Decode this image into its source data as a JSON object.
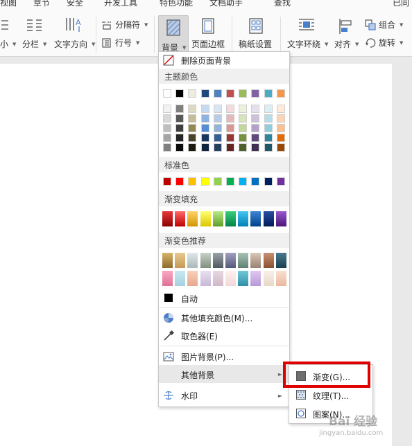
{
  "menubar": {
    "items": [
      "视图",
      "章节",
      "开发工具",
      "特色功能",
      "文档助手",
      "查找",
      "已同"
    ]
  },
  "ribbon": {
    "size_label": "小",
    "columns_label": "分栏",
    "text_direction_label": "文字方向",
    "separator_label": "分隔符",
    "line_number_label": "行号",
    "background_label": "背景",
    "page_border_label": "页面边框",
    "paper_setting_label": "稿纸设置",
    "wrap_label": "文字环绕",
    "align_label": "对齐",
    "group_label": "组合",
    "rotate_label": "旋转"
  },
  "menu": {
    "remove_bg": "删除页面背景",
    "theme_colors_header": "主题颜色",
    "standard_colors_header": "标准色",
    "gradient_fill_header": "渐变填充",
    "gradient_recommend_header": "渐变色推荐",
    "auto_label": "自动",
    "other_fill_color": "其他填充颜色(M)...",
    "eyedropper": "取色器(E)",
    "picture_bg": "图片背景(P)...",
    "other_bg": "其他背景",
    "watermark": "水印"
  },
  "submenu": {
    "gradient": "渐变(G)...",
    "texture": "纹理(T)...",
    "pattern": "图案(N)..."
  },
  "colors": {
    "theme_top": [
      "#ffffff",
      "#000000",
      "#eeece1",
      "#1f497d",
      "#4f81bd",
      "#c0504d",
      "#9bbb59",
      "#8064a2",
      "#4bacc6",
      "#f79646"
    ],
    "theme_shades": [
      [
        "#f2f2f2",
        "#d8d8d8",
        "#bfbfbf",
        "#a5a5a5",
        "#7f7f7f"
      ],
      [
        "#7f7f7f",
        "#595959",
        "#3f3f3f",
        "#262626",
        "#0c0c0c"
      ],
      [
        "#ddd9c3",
        "#c4bd97",
        "#938953",
        "#494429",
        "#1d1b10"
      ],
      [
        "#c6d9f0",
        "#8db3e2",
        "#548dd4",
        "#17365d",
        "#0f243e"
      ],
      [
        "#dbe5f1",
        "#b8cce4",
        "#95b3d7",
        "#366092",
        "#244061"
      ],
      [
        "#f2dcdb",
        "#e5b9b7",
        "#d99694",
        "#953734",
        "#632423"
      ],
      [
        "#ebf1dd",
        "#d7e3bc",
        "#c3d69b",
        "#76923c",
        "#4f6128"
      ],
      [
        "#e5e0ec",
        "#ccc1d9",
        "#b2a2c7",
        "#5f497a",
        "#3f3151"
      ],
      [
        "#dbeef3",
        "#b7dde8",
        "#92cddc",
        "#31859b",
        "#205867"
      ],
      [
        "#fdeada",
        "#fbd5b5",
        "#fac08f",
        "#e36c09",
        "#974806"
      ]
    ],
    "standard": [
      "#c00000",
      "#ff0000",
      "#ffc000",
      "#ffff00",
      "#92d050",
      "#00b050",
      "#00b0f0",
      "#0070c0",
      "#002060",
      "#7030a0"
    ],
    "gradient_fill": [
      [
        "#e8363a",
        "#8b0000"
      ],
      [
        "#ff6a6a",
        "#c00000"
      ],
      [
        "#ffd36a",
        "#d39500"
      ],
      [
        "#ffff70",
        "#d9c800"
      ],
      [
        "#b8e986",
        "#5f9e2a"
      ],
      [
        "#3ccf7a",
        "#00804a"
      ],
      [
        "#43c5f5",
        "#0080b5"
      ],
      [
        "#3c86d6",
        "#00408a"
      ],
      [
        "#2a4fa0",
        "#001a5c"
      ],
      [
        "#9a56cf",
        "#4a1678"
      ]
    ],
    "gradient_recommend_row1": [
      [
        "#d8b36a",
        "#8c6a2a"
      ],
      [
        "#e8c98f",
        "#c49a55"
      ],
      [
        "#e0e8e8",
        "#aab8b8"
      ],
      [
        "#c8d2c8",
        "#7f8f7f"
      ],
      [
        "#9aa2aa",
        "#505860"
      ],
      [
        "#a0a0c0",
        "#585878"
      ],
      [
        "#a8c4b8",
        "#5f8070"
      ],
      [
        "#d8c8b8",
        "#9a8070"
      ],
      [
        "#c89070",
        "#8a5030"
      ],
      [
        "#4a7a90",
        "#1a4050"
      ]
    ],
    "gradient_recommend_row2": [
      [
        "#f8a8c0",
        "#e07098"
      ],
      [
        "#c8e8f0",
        "#a8d0e0"
      ],
      [
        "#f8d0b8",
        "#e8a890"
      ],
      [
        "#e8e0f0",
        "#c8b8d8"
      ],
      [
        "#e8d8e0",
        "#d0b8c8"
      ],
      [
        "#fff0f0",
        "#f0d8d8"
      ],
      [
        "#70c8d8",
        "#3090a8"
      ],
      [
        "#e0c8f0",
        "#b898d8"
      ],
      [
        "#f8f0e8",
        "#e8d8c8"
      ],
      [
        "#fae0d0",
        "#eab8a0"
      ]
    ],
    "highlight": "#e00000",
    "accent_blue": "#4a7fcb"
  },
  "watermark_brand": {
    "logo_text": "Bai 经验",
    "url_text": "jingyan.baidu.com"
  }
}
